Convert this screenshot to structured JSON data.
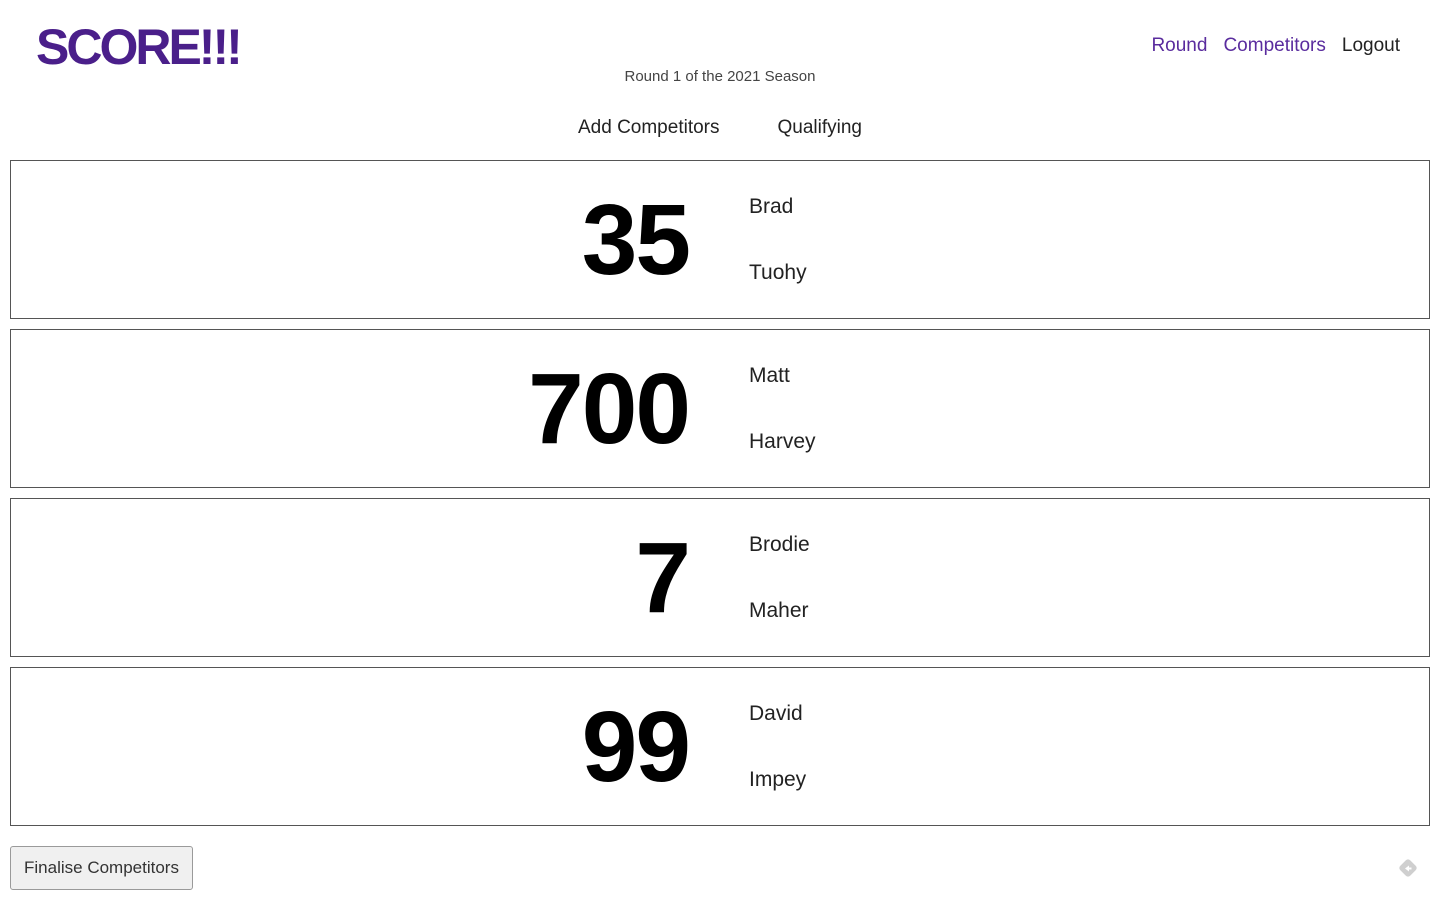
{
  "header": {
    "logo": "SCORE!!!",
    "subtitle": "Round 1 of the 2021 Season",
    "nav": [
      "Round",
      "Competitors",
      "Logout"
    ]
  },
  "tabs": [
    "Add Competitors",
    "Qualifying"
  ],
  "competitors": [
    {
      "score": "35",
      "first_name": "Brad",
      "last_name": "Tuohy"
    },
    {
      "score": "700",
      "first_name": "Matt",
      "last_name": "Harvey"
    },
    {
      "score": "7",
      "first_name": "Brodie",
      "last_name": "Maher"
    },
    {
      "score": "99",
      "first_name": "David",
      "last_name": "Impey"
    }
  ],
  "actions": {
    "finalise_label": "Finalise Competitors"
  },
  "colors": {
    "brand": "#4a1f8a",
    "link": "#5a2c9e"
  },
  "icons": {
    "corner": "diamond-arrow-icon"
  }
}
